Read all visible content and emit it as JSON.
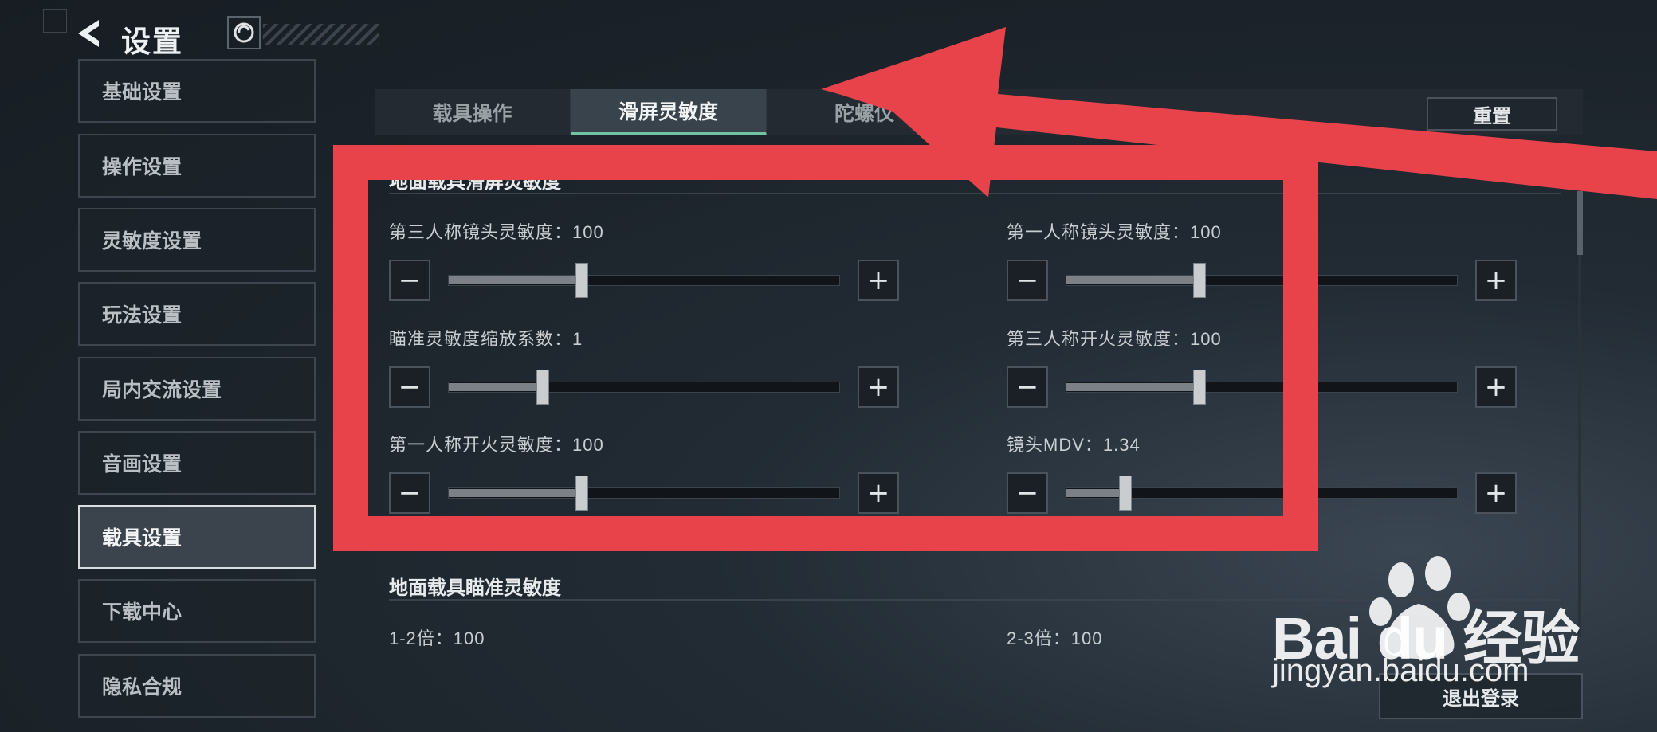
{
  "header": {
    "title": "设置"
  },
  "sidebar": {
    "items": [
      {
        "label": "基础设置"
      },
      {
        "label": "操作设置"
      },
      {
        "label": "灵敏度设置"
      },
      {
        "label": "玩法设置"
      },
      {
        "label": "局内交流设置"
      },
      {
        "label": "音画设置"
      },
      {
        "label": "载具设置"
      },
      {
        "label": "下载中心"
      },
      {
        "label": "隐私合规"
      }
    ],
    "active_index": 6
  },
  "tabs": [
    {
      "label": "载具操作"
    },
    {
      "label": "滑屏灵敏度"
    },
    {
      "label": "陀螺仪"
    }
  ],
  "active_tab": 1,
  "reset_label": "重置",
  "section1": {
    "title": "地面载具滑屏灵敏度",
    "settings": [
      {
        "label": "第三人称镜头灵敏度：100",
        "level": 0.34
      },
      {
        "label": "第一人称镜头灵敏度：100",
        "level": 0.34
      },
      {
        "label": "瞄准灵敏度缩放系数：1",
        "level": 0.24
      },
      {
        "label": "第三人称开火灵敏度：100",
        "level": 0.34
      },
      {
        "label": "第一人称开火灵敏度：100",
        "level": 0.34
      },
      {
        "label": "镜头MDV：1.34",
        "level": 0.15
      }
    ]
  },
  "section2": {
    "title": "地面载具瞄准灵敏度",
    "settings": [
      {
        "label": "1-2倍：100"
      },
      {
        "label": "2-3倍：100"
      }
    ]
  },
  "logout_label": "退出登录",
  "controls": {
    "minus": "−",
    "plus": "+"
  },
  "watermark": {
    "brand": "Bai du 经验",
    "url": "jingyan.baidu.com"
  },
  "colors": {
    "accent": "#72c3a4",
    "annotation": "#e8424a"
  }
}
